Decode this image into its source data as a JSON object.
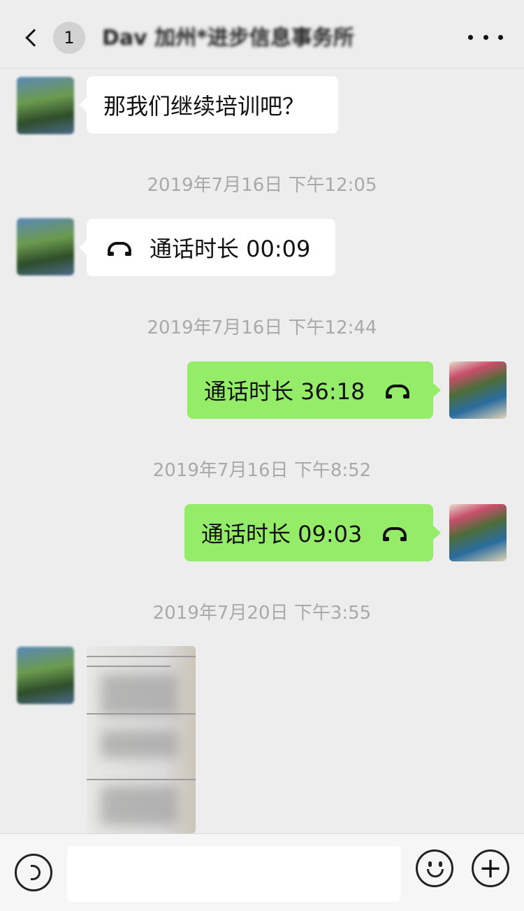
{
  "header": {
    "back_badge": "1",
    "title": "Dav    加州*进步信息事务所"
  },
  "messages": [
    {
      "side": "in",
      "type": "text",
      "text": "那我们继续培训吧？"
    },
    {
      "type": "timestamp",
      "text": "2019年7月16日 下午12:05"
    },
    {
      "side": "in",
      "type": "call",
      "text": "通话时长 00:09"
    },
    {
      "type": "timestamp",
      "text": "2019年7月16日 下午12:44"
    },
    {
      "side": "out",
      "type": "call",
      "text": "通话时长 36:18"
    },
    {
      "type": "timestamp",
      "text": "2019年7月16日 下午8:52"
    },
    {
      "side": "out",
      "type": "call",
      "text": "通话时长 09:03"
    },
    {
      "type": "timestamp",
      "text": "2019年7月20日 下午3:55"
    },
    {
      "side": "in",
      "type": "image"
    }
  ],
  "input_bar": {
    "voice_icon": "voice-icon",
    "emoji_icon": "emoji-icon",
    "plus_icon": "plus-icon",
    "text_value": ""
  },
  "colors": {
    "background": "#ededed",
    "outgoing_bubble": "#95ec69",
    "incoming_bubble": "#ffffff",
    "timestamp": "#a9a9a9"
  }
}
